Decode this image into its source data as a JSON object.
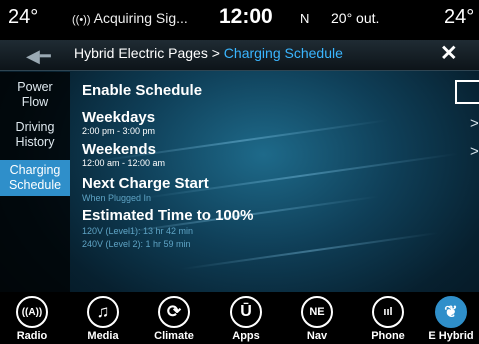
{
  "status_bar": {
    "temp_left": "24°",
    "radio_status": "Acquiring Sig...",
    "time": "12:00",
    "compass": "N",
    "outside_temp": "20° out.",
    "temp_right": "24°"
  },
  "header": {
    "breadcrumb_parent": "Hybrid Electric Pages > ",
    "breadcrumb_current": "Charging Schedule",
    "back_icon": "back-arrow-icon",
    "close_icon": "close-icon"
  },
  "sidebar": {
    "items": [
      {
        "label_line1": "Power",
        "label_line2": "Flow",
        "active": false
      },
      {
        "label_line1": "Driving",
        "label_line2": "History",
        "active": false
      },
      {
        "label_line1": "Charging",
        "label_line2": "Schedule",
        "active": true
      }
    ],
    "active_color": "#2f8fca"
  },
  "schedule": {
    "enable_label": "Enable Schedule",
    "weekdays_label": "Weekdays",
    "weekdays_time": "2:00 pm - 3:00 pm",
    "weekends_label": "Weekends",
    "weekends_time": "12:00 am - 12:00 am",
    "next_charge_label": "Next Charge Start",
    "next_charge_value": "When Plugged In",
    "est_time_label": "Estimated Time to 100%",
    "est_level1": "120V (Level1): 13 hr 42 min",
    "est_level2": "240V (Level 2): 1 hr 59 min"
  },
  "dock": {
    "items": [
      {
        "label": "Radio",
        "icon": "radio-icon",
        "glyph": "((A))"
      },
      {
        "label": "Media",
        "icon": "music-note-icon",
        "glyph": "♫"
      },
      {
        "label": "Climate",
        "icon": "climate-icon",
        "glyph": "⟳"
      },
      {
        "label": "Apps",
        "icon": "apps-icon",
        "glyph": "Ū"
      },
      {
        "label": "Nav",
        "icon": "compass-icon",
        "glyph": "NE"
      },
      {
        "label": "Phone",
        "icon": "phone-signal-icon",
        "glyph": "ııl"
      },
      {
        "label": "E Hybrid",
        "icon": "leaf-icon",
        "glyph": "❦",
        "active": true
      }
    ]
  },
  "colors": {
    "accent": "#3ab6ff",
    "background": "#0f3f58"
  }
}
